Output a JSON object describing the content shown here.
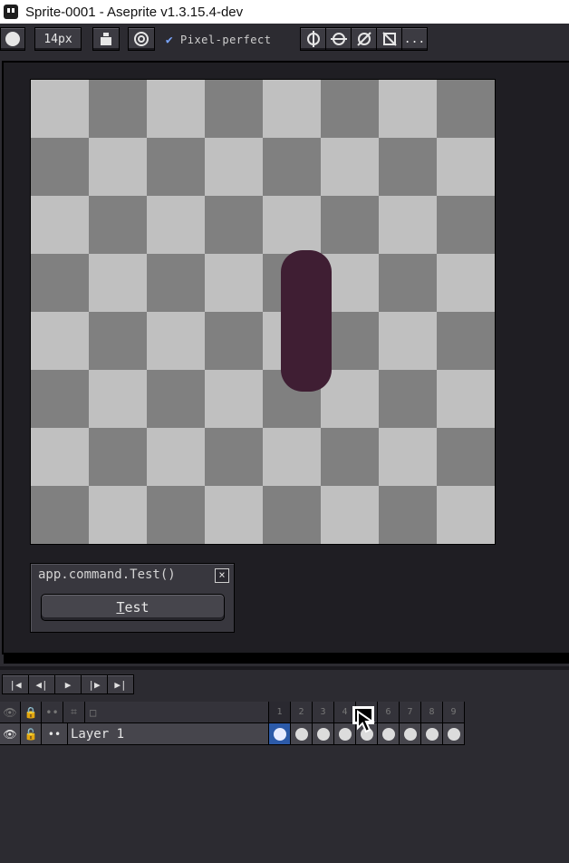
{
  "window": {
    "title": "Sprite-0001 - Aseprite v1.3.15.4-dev"
  },
  "toolbar": {
    "brush_size": "14px",
    "pixel_perfect_label": "Pixel-perfect",
    "pixel_perfect_checked": true,
    "more_label": "..."
  },
  "canvas": {
    "stroke_color": "#3f1e33",
    "checker_light": "#c0c0c0",
    "checker_dark": "#808080"
  },
  "dialog": {
    "title": "app.command.Test()",
    "close_glyph": "×",
    "button_label_first": "T",
    "button_label_rest": "est"
  },
  "timeline": {
    "frames": [
      "1",
      "2",
      "3",
      "4",
      "5",
      "6",
      "7",
      "8",
      "9"
    ],
    "active_frame": "1",
    "layer_name": "Layer 1"
  }
}
